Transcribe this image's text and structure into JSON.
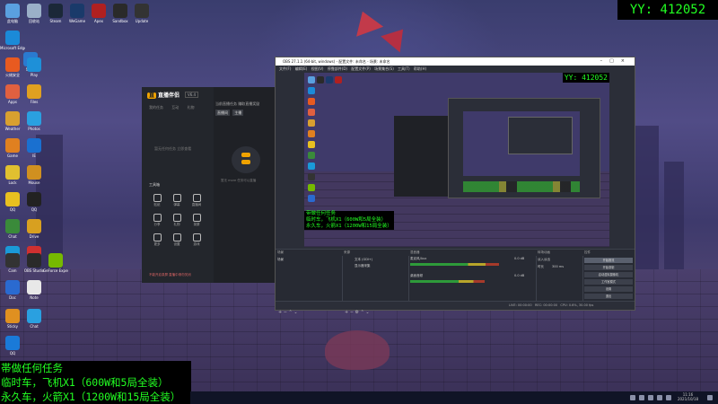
{
  "overlay": {
    "yy_label": "YY: 412052",
    "tasks": [
      "帯做任何任务",
      "临时车，飞机X1（600W和5局全装）",
      "永久车，火箭X1（1200W和15局全装）"
    ]
  },
  "desktop_icons": [
    {
      "label": "此电脑",
      "color": "#5aa0e0"
    },
    {
      "label": "回收站",
      "color": "#9ab0c8"
    },
    {
      "label": "Steam",
      "color": "#1b2838"
    },
    {
      "label": "WeGame",
      "color": "#1a3a6a"
    },
    {
      "label": "Apex",
      "color": "#b02020"
    },
    {
      "label": "Sandbox",
      "color": "#2a2a2a"
    },
    {
      "label": "Update",
      "color": "#333"
    },
    {
      "label": "Microsoft Edge",
      "color": "#1b8ad8"
    },
    {
      "label": "Store",
      "color": "#2a7ad0"
    },
    {
      "label": "火绒安全",
      "color": "#e85a20"
    },
    {
      "label": "Play",
      "color": "#1e90d8"
    },
    {
      "label": "Apps",
      "color": "#e06040"
    },
    {
      "label": "Files",
      "color": "#e0a020"
    },
    {
      "label": "Weather",
      "color": "#d8a030"
    },
    {
      "label": "Photos",
      "color": "#2aa0e0"
    },
    {
      "label": "Game",
      "color": "#e08020"
    },
    {
      "label": "IE",
      "color": "#1a70d0"
    },
    {
      "label": "Lock",
      "color": "#e0c030"
    },
    {
      "label": "Mouse",
      "color": "#d09020"
    },
    {
      "label": "QQ",
      "color": "#e8c020"
    },
    {
      "label": "QQ",
      "color": "#222"
    },
    {
      "label": "Chat",
      "color": "#3a8a3a"
    },
    {
      "label": "Drive",
      "color": "#d8a020"
    },
    {
      "label": "Net",
      "color": "#1a9ad8"
    },
    {
      "label": "Music",
      "color": "#d03030"
    },
    {
      "label": "Cam",
      "color": "#333"
    },
    {
      "label": "OBS Studio",
      "color": "#2a2a2a"
    },
    {
      "label": "GeForce Experience",
      "color": "#76b900"
    },
    {
      "label": "Doc",
      "color": "#2a6ad0"
    },
    {
      "label": "Note",
      "color": "#e8e8e8"
    },
    {
      "label": "Sticky",
      "color": "#e09020"
    },
    {
      "label": "Chat",
      "color": "#2aa0e0"
    },
    {
      "label": "QQ",
      "color": "#1a7ad8"
    }
  ],
  "taskbar": {
    "time": "11:16",
    "date": "2021/10/18"
  },
  "assistant": {
    "logo_badge": "直",
    "logo_text": "直播伴侣",
    "version": "V6.4",
    "tabs": [
      "我的任务",
      "互动",
      "礼物"
    ],
    "empty_text": "暂无任何任务 立即查看",
    "tools_label": "工具箱",
    "tools": [
      "贴纸",
      "弹幕",
      "直播间",
      "分享",
      "礼物",
      "录屏",
      "更多",
      "设置",
      "游戏"
    ],
    "top_text": "当前直播任务 赚取直播奖励",
    "chips": [
      "直播间",
      "主播"
    ],
    "hint": "暂无 more 任务可以直播",
    "warn": "不能开启录屏 直播中请勿关闭"
  },
  "obs": {
    "title": "OBS 27.1.1 (64-bit, windows) - 配置文件: 未命名 - 场景: 未命名",
    "menu": [
      "文件(F)",
      "编辑(E)",
      "视图(V)",
      "停靠部件(D)",
      "配置文件(P)",
      "场景集合(S)",
      "工具(T)",
      "帮助(H)"
    ],
    "yy_label": "YY: 412052",
    "preview_text": [
      "带做任何任务",
      "临时车，飞机X1（600W和5局全装）",
      "永久车，火箭X1（1200W和15局全装）"
    ],
    "dock_headers": [
      "场景",
      "来源",
      "混音器",
      "转场动画",
      "控件"
    ],
    "scene_item": "场景",
    "sources": [
      "文本 (GDI+)",
      "显示器采集"
    ],
    "mixer": [
      {
        "name": "麦克风/Aux",
        "db": "0.0 dB",
        "level": 0.72
      },
      {
        "name": "桌面音频",
        "db": "0.0 dB",
        "level": 0.6
      }
    ],
    "transition": {
      "name": "淡入淡出",
      "duration_label": "时长",
      "duration": "300 ms"
    },
    "controls": [
      "开始推流",
      "开始录制",
      "启动虚拟摄像机",
      "工作室模式",
      "设置",
      "退出"
    ],
    "status": [
      "LIVE: 00:00:00",
      "REC: 00:00:00",
      "CPU: 0.6%, 30.00 fps"
    ]
  }
}
